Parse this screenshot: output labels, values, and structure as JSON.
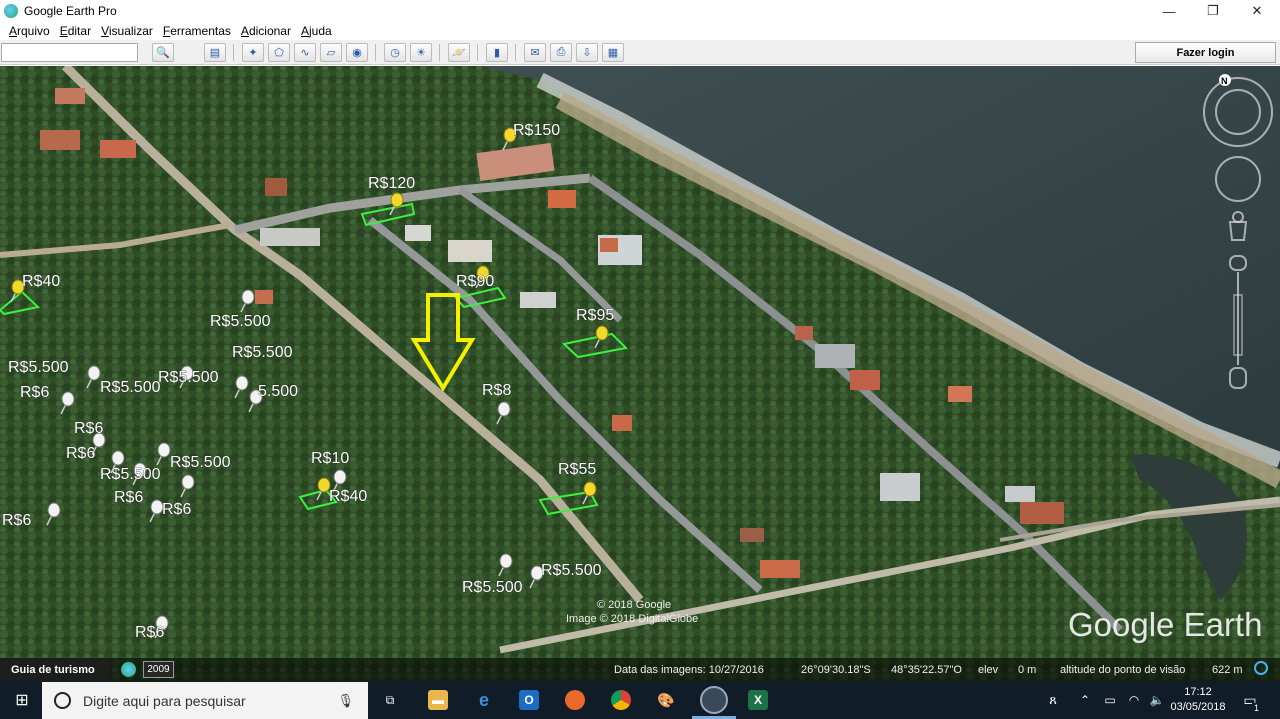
{
  "window": {
    "title": "Google Earth Pro",
    "minimize": "—",
    "maximize": "❐",
    "close": "✕"
  },
  "menu": [
    "Arquivo",
    "Editar",
    "Visualizar",
    "Ferramentas",
    "Adicionar",
    "Ajuda"
  ],
  "search": {
    "value": "",
    "placeholder": ""
  },
  "toolbar": {
    "login_label": "Fazer login"
  },
  "map": {
    "compass_label": "N",
    "labels": [
      {
        "text": "R$150"
      },
      {
        "text": "R$120"
      },
      {
        "text": "R$40"
      },
      {
        "text": "R$90"
      },
      {
        "text": "R$5.500"
      },
      {
        "text": "R$95"
      },
      {
        "text": "R$5.500"
      },
      {
        "text": "R$5.500"
      },
      {
        "text": "R$5.500"
      },
      {
        "text": "R$5.500"
      },
      {
        "text": "5.500"
      },
      {
        "text": "R$6"
      },
      {
        "text": "R$8"
      },
      {
        "text": "R$6"
      },
      {
        "text": "R$6"
      },
      {
        "text": "R$5.500"
      },
      {
        "text": "R$5.500"
      },
      {
        "text": "R$10"
      },
      {
        "text": "R$55"
      },
      {
        "text": "R$6"
      },
      {
        "text": "R$6"
      },
      {
        "text": "R$40"
      },
      {
        "text": "R$6"
      },
      {
        "text": "R$5.500"
      },
      {
        "text": "R$5.500"
      },
      {
        "text": "R$6"
      }
    ],
    "copyright1": "© 2018 Google",
    "copyright2": "Image © 2018 DigitalGlobe",
    "watermark": "Google Earth"
  },
  "status": {
    "tour_guide": "Guia de turismo",
    "year": "2009",
    "image_date": "Data das imagens: 10/27/2016",
    "lat": "26°09'30.18\"S",
    "lon": "48°35'22.57\"O",
    "elev_label": "elev",
    "elev_value": "0 m",
    "eye_alt_label": "altitude do ponto de visão",
    "eye_alt_value": "622 m"
  },
  "taskbar": {
    "search_placeholder": "Digite aqui para pesquisar",
    "time": "17:12",
    "date": "03/05/2018",
    "notif_count": "1"
  },
  "colors": {
    "pin": "#f2d82a",
    "parcel": "#3cf040",
    "arrow": "#f4f000",
    "taskbar": "#101c28"
  }
}
